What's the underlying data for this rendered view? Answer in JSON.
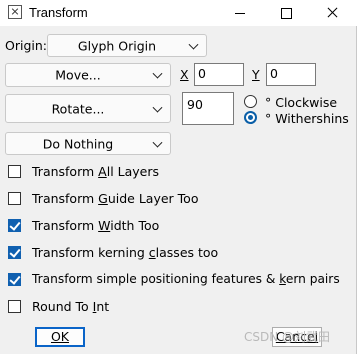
{
  "window": {
    "title": "Transform"
  },
  "origin": {
    "label": "Origin:",
    "value": "Glyph Origin"
  },
  "move": {
    "label": "Move...",
    "x_label": "X",
    "x_value": "0",
    "y_label": "Y",
    "y_value": "0"
  },
  "rotate": {
    "label": "Rotate...",
    "angle": "90",
    "clockwise_label": "° Clockwise",
    "withershins_label": "° Withershins",
    "selected": "withershins"
  },
  "third_action": {
    "label": "Do Nothing"
  },
  "options": {
    "all_layers": {
      "pre": "Transform ",
      "u": "A",
      "post": "ll Layers",
      "checked": false
    },
    "guide_layer": {
      "pre": "Transform ",
      "u": "G",
      "post": "uide Layer Too",
      "checked": false
    },
    "width": {
      "pre": "Transform ",
      "u": "W",
      "post": "idth Too",
      "checked": true
    },
    "kerning": {
      "pre": "Transform kerning ",
      "u": "c",
      "post": "lasses too",
      "checked": true
    },
    "positioning": {
      "pre": "Transform simple positioning features & ",
      "u": "k",
      "post": "ern pairs",
      "checked": true
    },
    "round": {
      "pre": "Round To ",
      "u": "I",
      "post": "nt",
      "checked": false
    }
  },
  "buttons": {
    "ok": "OK",
    "cancel": "Cancel"
  },
  "watermark": "CSDN @刘武田"
}
